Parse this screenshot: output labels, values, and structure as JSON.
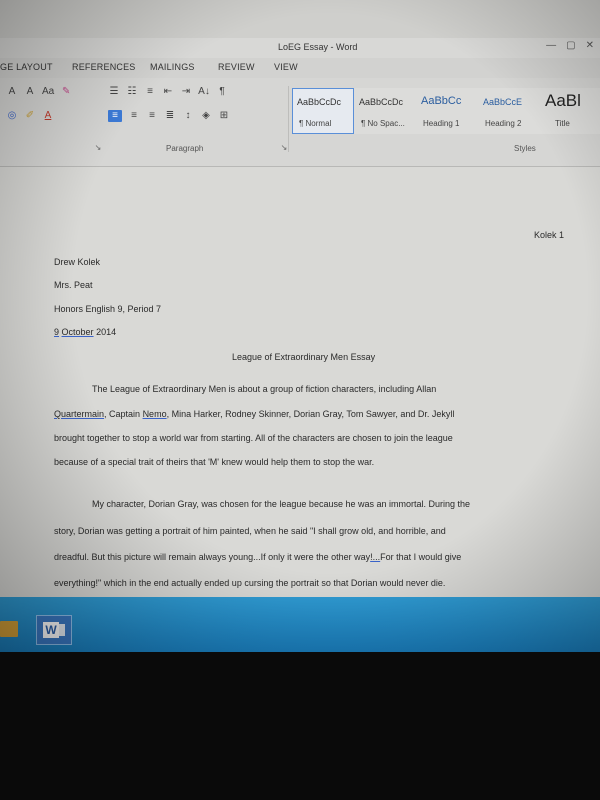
{
  "window": {
    "title": "LoEG Essay - Word"
  },
  "ribbon_tabs": [
    "GE LAYOUT",
    "REFERENCES",
    "MAILINGS",
    "REVIEW",
    "VIEW"
  ],
  "ribbon": {
    "font_buttons": [
      "A",
      "A",
      "Aa",
      "A"
    ],
    "paragraph_marks": [
      "¶"
    ],
    "sort_label": "A↓",
    "group_paragraph": "Paragraph",
    "group_styles": "Styles",
    "styles": [
      {
        "sample": "AaBbCcDc",
        "name": "¶ Normal"
      },
      {
        "sample": "AaBbCcDc",
        "name": "¶ No Spac..."
      },
      {
        "sample": "AaBbCc",
        "name": "Heading 1"
      },
      {
        "sample": "AaBbCcE",
        "name": "Heading 2"
      },
      {
        "sample": "AaBl",
        "name": "Title"
      }
    ],
    "style_more": "A"
  },
  "document": {
    "header_right": "Kolek 1",
    "author": "Drew Kolek",
    "teacher": "Mrs. Peat",
    "course": "Honors English 9, Period 7",
    "date_day": "9",
    "date_month": "October",
    "date_year": "2014",
    "title": "League of Extraordinary Men Essay",
    "p1": {
      "l1": "The League of Extraordinary Men is about a group of fiction characters, including Allan",
      "l2_a": "Quartermain",
      "l2_b": ", Captain ",
      "l2_c": "Nemo",
      "l2_d": ", Mina Harker, Rodney Skinner, Dorian Gray, Tom Sawyer, and Dr. Jekyll",
      "l3": "brought together to stop a world war from starting. All of the characters are chosen to join the league",
      "l4": "because of a special trait of theirs that 'M' knew would help them to stop the war."
    },
    "p2": {
      "l1": "My character, Dorian Gray, was chosen for the league because he was an immortal. During the",
      "l2": "story, Dorian was getting a portrait of him painted, when he said \"I shall grow old, and horrible, and",
      "l3_a": "dreadful. But this picture will remain always young...If only it were the other way",
      "l3_b": "!...",
      "l3_c": "For that I would give",
      "l4": "everything!\" which in the end actually ended up cursing the portrait so that Dorian would never die."
    }
  },
  "taskbar": {
    "word_letter": "W"
  }
}
